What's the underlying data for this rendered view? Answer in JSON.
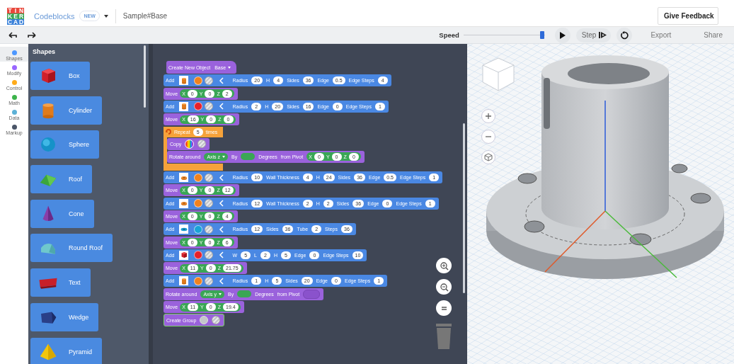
{
  "header": {
    "logo": [
      "T",
      "I",
      "N",
      "K",
      "E",
      "R",
      "C",
      "A",
      "D"
    ],
    "app_name": "Codeblocks",
    "badge": "NEW",
    "design_name": "Sample#Base",
    "feedback_button": "Give Feedback"
  },
  "toolbar": {
    "speed_label": "Speed",
    "speed": {
      "level": 0.97
    },
    "step_button": "Step",
    "export_button": "Export",
    "share_button": "Share"
  },
  "categories": [
    {
      "label": "Shapes",
      "color": "#4c97ff",
      "selected": true
    },
    {
      "label": "Modify",
      "color": "#9966ff",
      "selected": false
    },
    {
      "label": "Control",
      "color": "#ffab19",
      "selected": false
    },
    {
      "label": "Math",
      "color": "#3cb44b",
      "selected": false
    },
    {
      "label": "Data",
      "color": "#5cb1d6",
      "selected": false
    },
    {
      "label": "Markup",
      "color": "#4a5568",
      "selected": false
    }
  ],
  "palette": {
    "title": "Shapes",
    "items": [
      {
        "label": "Box",
        "kind": "box"
      },
      {
        "label": "Cylinder",
        "kind": "cylinder"
      },
      {
        "label": "Sphere",
        "kind": "sphere"
      },
      {
        "label": "Roof",
        "kind": "roof"
      },
      {
        "label": "Cone",
        "kind": "cone"
      },
      {
        "label": "Round Roof",
        "kind": "roundroof"
      },
      {
        "label": "Text",
        "kind": "text"
      },
      {
        "label": "Wedge",
        "kind": "wedge"
      },
      {
        "label": "Pyramid",
        "kind": "pyramid"
      }
    ]
  },
  "blocks": [
    {
      "kind": "create",
      "label": "Create New Object",
      "dropdown": "Base"
    },
    {
      "kind": "add",
      "label": "Add",
      "thumbnail": {
        "kind": "cylinder"
      },
      "color": "#f0821e",
      "params": [
        {
          "label": "Radius",
          "value": "20"
        },
        {
          "label": "H",
          "value": "4"
        },
        {
          "label": "Sides",
          "value": "36"
        },
        {
          "label": "Edge",
          "value": "0.5"
        },
        {
          "label": "Edge Steps",
          "value": "4"
        }
      ]
    },
    {
      "kind": "move",
      "label": "Move",
      "coords": [
        {
          "label": "X",
          "value": "0"
        },
        {
          "label": "Y",
          "value": "0"
        },
        {
          "label": "Z",
          "value": "2"
        }
      ]
    },
    {
      "kind": "add",
      "label": "Add",
      "thumbnail": {
        "kind": "cylinder"
      },
      "color": "#e8202a",
      "params": [
        {
          "label": "Radius",
          "value": "2"
        },
        {
          "label": "H",
          "value": "20"
        },
        {
          "label": "Sides",
          "value": "16"
        },
        {
          "label": "Edge",
          "value": "0"
        },
        {
          "label": "Edge Steps",
          "value": "1"
        }
      ]
    },
    {
      "kind": "move",
      "label": "Move",
      "coords": [
        {
          "label": "X",
          "value": "16"
        },
        {
          "label": "Y",
          "value": "0"
        },
        {
          "label": "Z",
          "value": "0"
        }
      ]
    },
    {
      "kind": "repeat",
      "label": "Repeat",
      "value": "5",
      "suffix": "times",
      "children": [
        {
          "kind": "copy",
          "label": "Copy"
        },
        {
          "kind": "rotate",
          "label": "Rotate around",
          "axis": "Axis z",
          "by": "By",
          "degrees": "Degrees",
          "pivot_label": "from Pivot",
          "pivot": [
            {
              "label": "X",
              "value": "0"
            },
            {
              "label": "Y",
              "value": "0"
            },
            {
              "label": "Z",
              "value": "0"
            }
          ]
        }
      ]
    },
    {
      "kind": "add",
      "label": "Add",
      "thumbnail": {
        "kind": "tube"
      },
      "color": "#f0821e",
      "params": [
        {
          "label": "Radius",
          "value": "10"
        },
        {
          "label": "Wall Thickness",
          "value": "4"
        },
        {
          "label": "H",
          "value": "24"
        },
        {
          "label": "Sides",
          "value": "36"
        },
        {
          "label": "Edge",
          "value": "0.5"
        },
        {
          "label": "Edge Steps",
          "value": "1"
        }
      ]
    },
    {
      "kind": "move",
      "label": "Move",
      "coords": [
        {
          "label": "X",
          "value": "0"
        },
        {
          "label": "Y",
          "value": "0"
        },
        {
          "label": "Z",
          "value": "12"
        }
      ]
    },
    {
      "kind": "add",
      "label": "Add",
      "thumbnail": {
        "kind": "tube"
      },
      "color": "#f0821e",
      "params": [
        {
          "label": "Radius",
          "value": "12"
        },
        {
          "label": "Wall Thickness",
          "value": "2"
        },
        {
          "label": "H",
          "value": "2"
        },
        {
          "label": "Sides",
          "value": "36"
        },
        {
          "label": "Edge",
          "value": "0"
        },
        {
          "label": "Edge Steps",
          "value": "1"
        }
      ]
    },
    {
      "kind": "move",
      "label": "Move",
      "coords": [
        {
          "label": "X",
          "value": "0"
        },
        {
          "label": "Y",
          "value": "0"
        },
        {
          "label": "Z",
          "value": "4"
        }
      ]
    },
    {
      "kind": "add",
      "label": "Add",
      "thumbnail": {
        "kind": "torus"
      },
      "color": "#1ba3d6",
      "params": [
        {
          "label": "Radius",
          "value": "12"
        },
        {
          "label": "Sides",
          "value": "36"
        },
        {
          "label": "Tube",
          "value": "2"
        },
        {
          "label": "Steps",
          "value": "36"
        }
      ]
    },
    {
      "kind": "move",
      "label": "Move",
      "coords": [
        {
          "label": "X",
          "value": "0"
        },
        {
          "label": "Y",
          "value": "0"
        },
        {
          "label": "Z",
          "value": "6"
        }
      ]
    },
    {
      "kind": "add",
      "label": "Add",
      "thumbnail": {
        "kind": "box"
      },
      "color": "#e8202a",
      "params": [
        {
          "label": "W",
          "value": "5"
        },
        {
          "label": "L",
          "value": "2"
        },
        {
          "label": "H",
          "value": "5"
        },
        {
          "label": "Edge",
          "value": "0"
        },
        {
          "label": "Edge Steps",
          "value": "10"
        }
      ]
    },
    {
      "kind": "move",
      "label": "Move",
      "coords": [
        {
          "label": "X",
          "value": "11"
        },
        {
          "label": "Y",
          "value": "0"
        },
        {
          "label": "Z",
          "value": "21.75"
        }
      ]
    },
    {
      "kind": "add",
      "label": "Add",
      "thumbnail": {
        "kind": "cylinder"
      },
      "color": "#f0821e",
      "params": [
        {
          "label": "Radius",
          "value": "1"
        },
        {
          "label": "H",
          "value": "5"
        },
        {
          "label": "Sides",
          "value": "20"
        },
        {
          "label": "Edge",
          "value": "0"
        },
        {
          "label": "Edge Steps",
          "value": "1"
        }
      ]
    },
    {
      "kind": "rotate",
      "label": "Rotate around",
      "axis": "Axis y",
      "by": "By",
      "degrees": "Degrees",
      "pivot_label": "from Pivot"
    },
    {
      "kind": "move",
      "label": "Move",
      "coords": [
        {
          "label": "X",
          "value": "11"
        },
        {
          "label": "Y",
          "value": "0"
        },
        {
          "label": "Z",
          "value": "19.4"
        }
      ]
    },
    {
      "kind": "group",
      "label": "Create Group"
    }
  ]
}
